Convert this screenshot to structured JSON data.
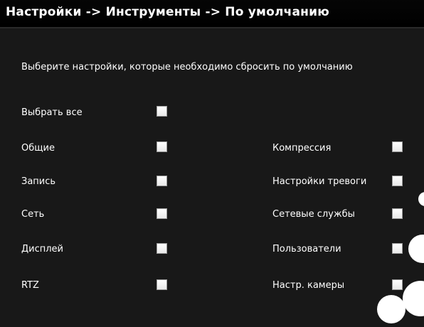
{
  "title": "Настройки -> Инструменты -> По умолчанию",
  "instruction": "Выберите настройки, которые необходимо сбросить по умолчанию",
  "select_all": {
    "label": "Выбрать все",
    "checked": false
  },
  "left_options": [
    {
      "label": "Общие",
      "checked": false
    },
    {
      "label": "Запись",
      "checked": false
    },
    {
      "label": "Сеть",
      "checked": false
    },
    {
      "label": "Дисплей",
      "checked": false
    },
    {
      "label": "RTZ",
      "checked": false
    }
  ],
  "right_options": [
    {
      "label": "Компрессия",
      "checked": false
    },
    {
      "label": "Настройки тревоги",
      "checked": false
    },
    {
      "label": "Сетевые службы",
      "checked": false
    },
    {
      "label": "Пользователи",
      "checked": false
    },
    {
      "label": "Настр. камеры",
      "checked": false
    }
  ]
}
